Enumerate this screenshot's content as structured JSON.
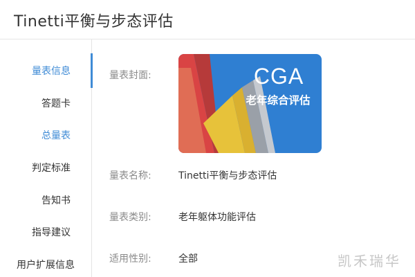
{
  "header": {
    "title": "Tinetti平衡与步态评估"
  },
  "sidebar": {
    "items": [
      {
        "label": "量表信息",
        "active": true
      },
      {
        "label": "答题卡",
        "active": false
      },
      {
        "label": "总量表",
        "active": true
      },
      {
        "label": "判定标准",
        "active": false
      },
      {
        "label": "告知书",
        "active": false
      },
      {
        "label": "指导建议",
        "active": false
      },
      {
        "label": "用户扩展信息",
        "active": false
      }
    ]
  },
  "content": {
    "cover_label": "量表封面:",
    "cover": {
      "title": "CGA",
      "subtitle": "老年综合评估"
    },
    "fields": [
      {
        "label": "量表名称:",
        "value": "Tinetti平衡与步态评估"
      },
      {
        "label": "量表类别:",
        "value": "老年躯体功能评估"
      },
      {
        "label": "适用性别:",
        "value": "全部"
      }
    ]
  },
  "watermark": "凯禾瑞华",
  "colors": {
    "accent": "#3f8bd6",
    "cover_blue": "#2f7fd2"
  }
}
